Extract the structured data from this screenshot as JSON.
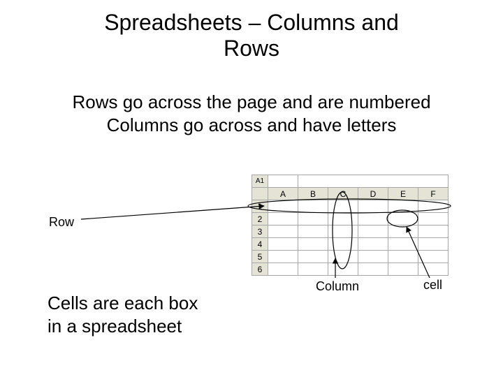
{
  "title_line1": "Spreadsheets – Columns and",
  "title_line2": "Rows",
  "body_line1": "Rows go across the page and are numbered",
  "body_line2": "Columns go across and have letters",
  "label_row": "Row",
  "label_column": "Column",
  "label_cell": "cell",
  "cells_text_line1": "Cells are each box",
  "cells_text_line2": "in a spreadsheet",
  "sheet": {
    "name_box": "A1",
    "columns": [
      "A",
      "B",
      "C",
      "D",
      "E",
      "F"
    ],
    "rows": [
      "1",
      "2",
      "3",
      "4",
      "5",
      "6"
    ]
  }
}
